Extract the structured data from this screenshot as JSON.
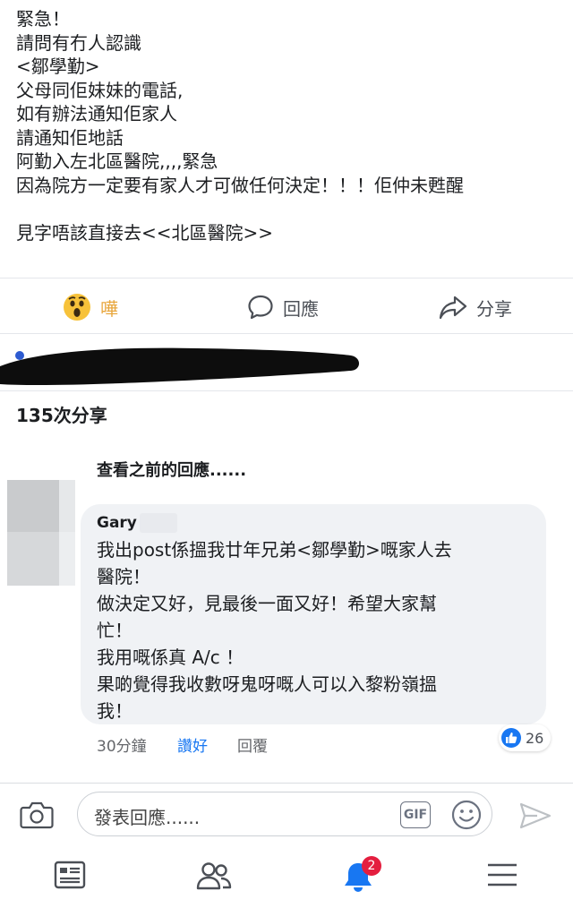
{
  "post": {
    "lines": [
      "緊急！",
      "請問有冇人認識",
      "<鄒學勤>",
      "父母同佢妹妹的電話,",
      "如有辦法通知佢家人",
      "請通知佢地話",
      "阿勤入左北區醫院,,,,緊急",
      "因為院方一定要有家人才可做任何決定！！！佢仲未甦醒",
      "",
      "見字唔該直接去<<北區醫院>>"
    ]
  },
  "actions": {
    "wow_label": "嘩",
    "comment_label": "回應",
    "share_label": "分享"
  },
  "shares_count": "135次分享",
  "view_previous": "查看之前的回應......",
  "comment": {
    "author": "Gary",
    "lines": [
      "我出post係搵我廿年兄弟<鄒學勤>嘅家人去",
      "醫院！",
      "做決定又好，見最後一面又好！希望大家幫",
      "忙！",
      "我用嘅係真 A/c ！",
      "果啲覺得我收數呀鬼呀嘅人可以入黎粉嶺搵",
      "我！"
    ],
    "time": "30分鐘",
    "like_label": "讚好",
    "reply_label": "回覆",
    "like_count": "26"
  },
  "composer": {
    "placeholder": "發表回應......",
    "gif_label": "GIF"
  },
  "tabbar": {
    "notification_badge": "2"
  },
  "colors": {
    "accent": "#1877f2",
    "wow": "#e8a63c",
    "badge": "#e41e3f"
  }
}
